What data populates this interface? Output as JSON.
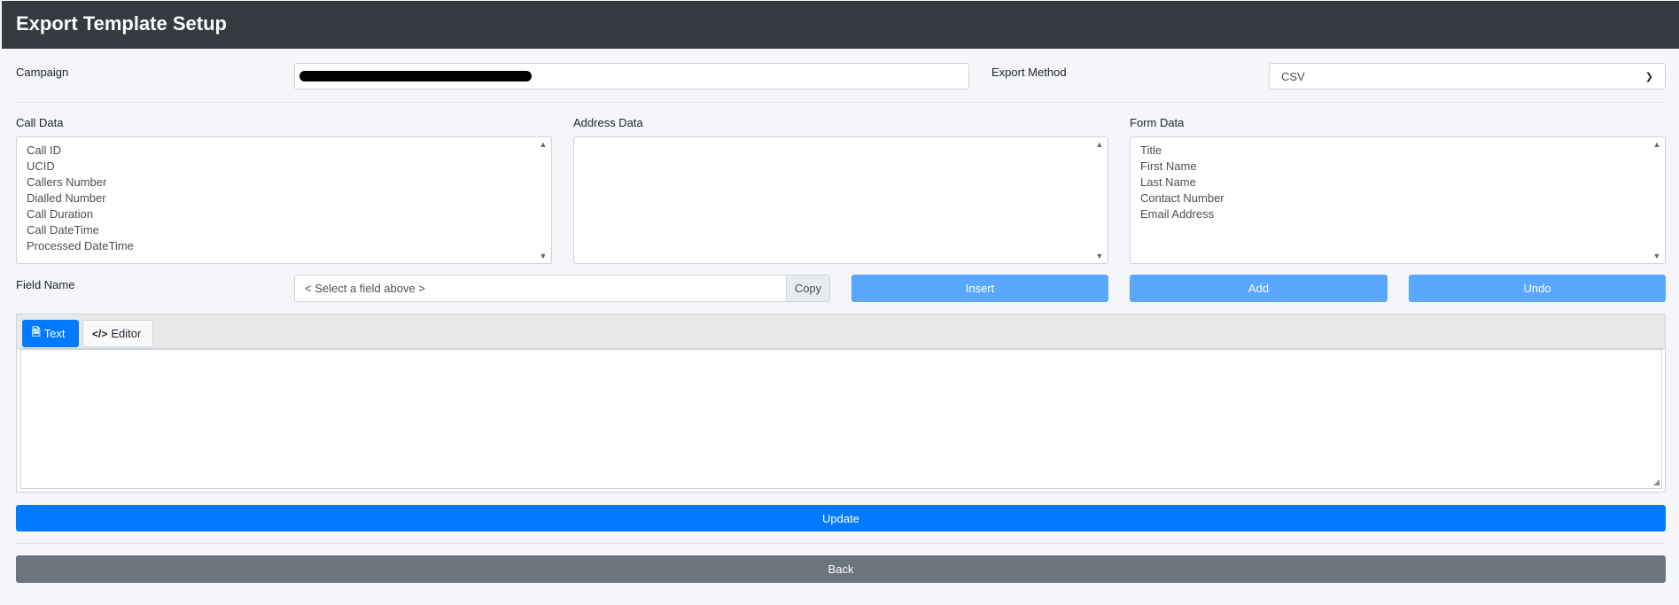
{
  "header": {
    "title": "Export Template Setup"
  },
  "campaign": {
    "label": "Campaign",
    "value": ""
  },
  "export_method": {
    "label": "Export Method",
    "selected": "CSV"
  },
  "call_data": {
    "label": "Call Data",
    "items": [
      "Call ID",
      "UCID",
      "Callers Number",
      "Dialled Number",
      "Call Duration",
      "Call DateTime",
      "Processed DateTime"
    ]
  },
  "address_data": {
    "label": "Address Data",
    "items": []
  },
  "form_data": {
    "label": "Form Data",
    "items": [
      "Title",
      "First Name",
      "Last Name",
      "Contact Number",
      "Email Address"
    ]
  },
  "field_name": {
    "label": "Field Name",
    "placeholder": "< Select a field above >",
    "copy_label": "Copy"
  },
  "actions": {
    "insert": "Insert",
    "add": "Add",
    "undo": "Undo"
  },
  "editor": {
    "tab_text": "Text",
    "tab_editor": "Editor",
    "content": ""
  },
  "footer": {
    "update": "Update",
    "back": "Back"
  },
  "icons": {
    "text_tab": "file-icon",
    "editor_tab": "code-icon",
    "select_caret": "chevron-down-icon",
    "scroll_up": "scroll-up-arrow",
    "scroll_down": "scroll-down-arrow",
    "resize": "resize-handle-icon"
  },
  "colors": {
    "header_bg": "#343a40",
    "primary": "#007bff",
    "primary_light": "#59a8fd",
    "secondary": "#6c757d"
  }
}
